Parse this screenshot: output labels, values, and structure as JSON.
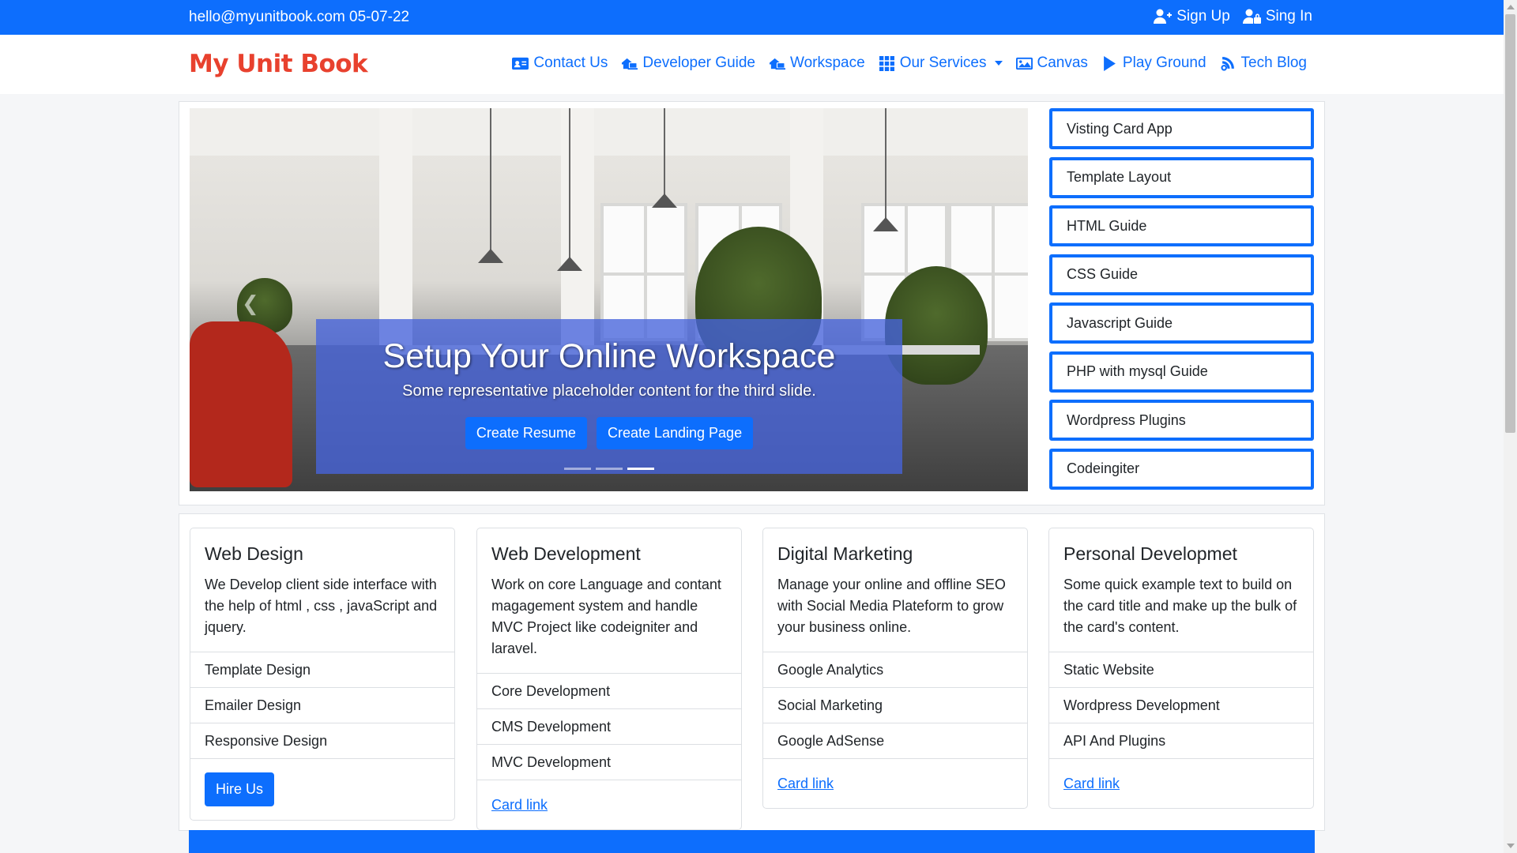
{
  "topbar": {
    "contact": "hello@myunitbook.com 05-07-22",
    "signup": "Sign Up",
    "signin": "Sing In"
  },
  "navbar": {
    "brand": "My Unit Book",
    "items": [
      {
        "label": "Contact Us",
        "icon": "id-card-icon"
      },
      {
        "label": "Developer Guide",
        "icon": "laptop-house-icon"
      },
      {
        "label": "Workspace",
        "icon": "laptop-house-icon"
      },
      {
        "label": "Our Services",
        "icon": "grid-icon",
        "dropdown": true
      },
      {
        "label": "Canvas",
        "icon": "image-icon"
      },
      {
        "label": "Play Ground",
        "icon": "play-icon"
      },
      {
        "label": "Tech Blog",
        "icon": "blog-icon"
      }
    ]
  },
  "carousel": {
    "title": "Setup Your Online Workspace",
    "text": "Some representative placeholder content for the third slide.",
    "btn1": "Create Resume",
    "btn2": "Create Landing Page",
    "slides": 3,
    "active_slide": 3
  },
  "side_list": [
    "Visting Card App",
    "Template Layout",
    "HTML Guide",
    "CSS Guide",
    "Javascript Guide",
    "PHP with mysql Guide",
    "Wordpress Plugins",
    "Codeingiter"
  ],
  "cards": [
    {
      "title": "Web Design",
      "text": "We Develop client side interface with the help of html , css , javaScript and jquery.",
      "items": [
        "Template Design",
        "Emailer Design",
        "Responsive Design"
      ],
      "footer_button": "Hire Us"
    },
    {
      "title": "Web Development",
      "text": "Work on core Language and contant magagement system and handle MVC Project like codeigniter and laravel.",
      "items": [
        "Core Development",
        "CMS Development",
        "MVC Development"
      ],
      "footer_link": "Card link"
    },
    {
      "title": "Digital Marketing",
      "text": "Manage your online and offline SEO with Social Media Plateform to grow your business online.",
      "items": [
        "Google Analytics",
        "Social Marketing",
        "Google AdSense"
      ],
      "footer_link": "Card link"
    },
    {
      "title": "Personal Developmet",
      "text": "Some quick example text to build on the card title and make up the bulk of the card's content.",
      "items": [
        "Static Website",
        "Wordpress Development",
        "API And Plugins"
      ],
      "footer_link": "Card link"
    }
  ],
  "colors": {
    "primary": "#0d6efd",
    "brand": "#e8412e"
  }
}
